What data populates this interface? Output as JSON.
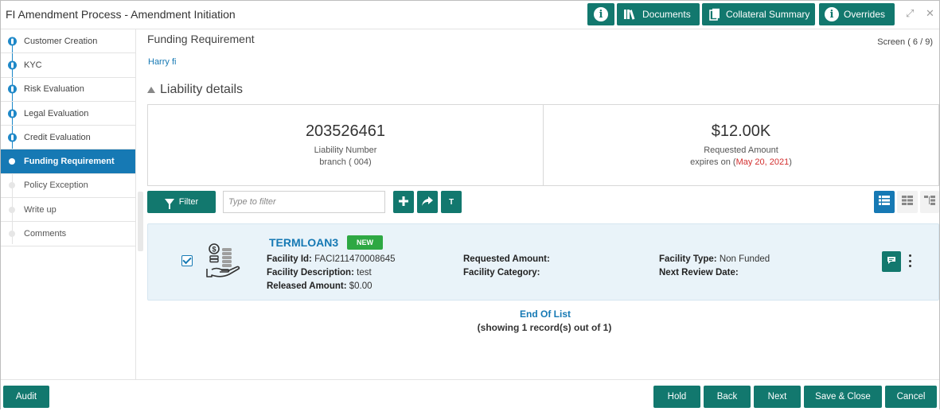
{
  "header": {
    "title": "FI Amendment Process - Amendment Initiation",
    "buttons": {
      "info": "",
      "documents": "Documents",
      "collateral_summary": "Collateral Summary",
      "overrides": "Overrides"
    }
  },
  "sidebar": {
    "items": [
      {
        "label": "Customer Creation",
        "state": "done"
      },
      {
        "label": "KYC",
        "state": "done"
      },
      {
        "label": "Risk Evaluation",
        "state": "done"
      },
      {
        "label": "Legal Evaluation",
        "state": "done"
      },
      {
        "label": "Credit Evaluation",
        "state": "done"
      },
      {
        "label": "Funding Requirement",
        "state": "active"
      },
      {
        "label": "Policy Exception",
        "state": "pending"
      },
      {
        "label": "Write up",
        "state": "pending"
      },
      {
        "label": "Comments",
        "state": "pending"
      }
    ]
  },
  "main": {
    "title": "Funding Requirement",
    "screen_indicator": "Screen ( 6 / 9)",
    "applicant": "Harry fi",
    "section_title": "Liability details",
    "summary": {
      "liability_number": "203526461",
      "liability_label": "Liability Number",
      "branch": "branch ( 004)",
      "requested_amount": "$12.00K",
      "requested_label": "Requested Amount",
      "expires_prefix": "expires on (",
      "expires_date": "May 20, 2021",
      "expires_suffix": ")"
    },
    "toolbar": {
      "filter_label": "Filter",
      "filter_placeholder": "Type to filter",
      "t_label": "T"
    },
    "card": {
      "name": "TERMLOAN3",
      "badge": "NEW",
      "facility_id_label": "Facility Id:",
      "facility_id": "FACI211470008645",
      "facility_desc_label": "Facility Description:",
      "facility_desc": "test",
      "released_label": "Released Amount:",
      "released": "$0.00",
      "requested_label": "Requested Amount:",
      "requested": "",
      "category_label": "Facility Category:",
      "category": "",
      "type_label": "Facility Type:",
      "type": "Non Funded",
      "review_label": "Next Review Date:",
      "review": "",
      "checked": true
    },
    "end_of_list": "End Of List",
    "showing": "(showing 1 record(s) out of 1)"
  },
  "footer": {
    "audit": "Audit",
    "hold": "Hold",
    "back": "Back",
    "next": "Next",
    "save_close": "Save & Close",
    "cancel": "Cancel"
  },
  "colors": {
    "primary": "#12786e",
    "accent_blue": "#1679b4",
    "badge_green": "#2ea843",
    "date_red": "#d32f2f"
  }
}
